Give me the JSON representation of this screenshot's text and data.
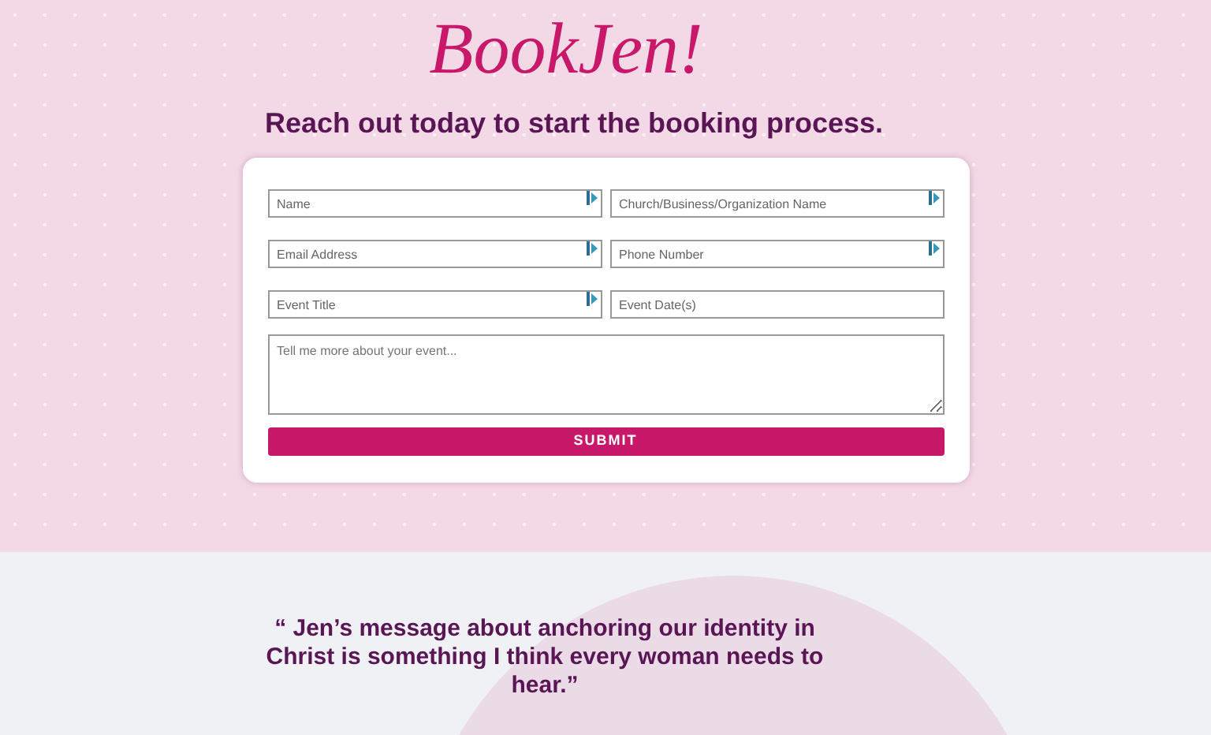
{
  "logo": {
    "text": "BookJen!"
  },
  "heading": "Reach out today to start the booking process.",
  "form": {
    "fields": [
      {
        "kind": "input",
        "placeholder": "Name",
        "autofill_icon": true
      },
      {
        "kind": "input",
        "placeholder": "Church/Business/Organization Name",
        "autofill_icon": true
      },
      {
        "kind": "input",
        "placeholder": "Email Address",
        "autofill_icon": true
      },
      {
        "kind": "input",
        "placeholder": "Phone Number",
        "autofill_icon": true
      },
      {
        "kind": "input",
        "placeholder": "Event Title",
        "autofill_icon": true
      },
      {
        "kind": "input",
        "placeholder": "Event Date(s)",
        "autofill_icon": false
      },
      {
        "kind": "textarea",
        "placeholder": "Tell me more about your event..."
      }
    ],
    "submit": "SUBMIT"
  },
  "testimonial": {
    "quote": "“ Jen’s message about anchoring our identity in Christ is something I think every woman needs to hear.”"
  }
}
